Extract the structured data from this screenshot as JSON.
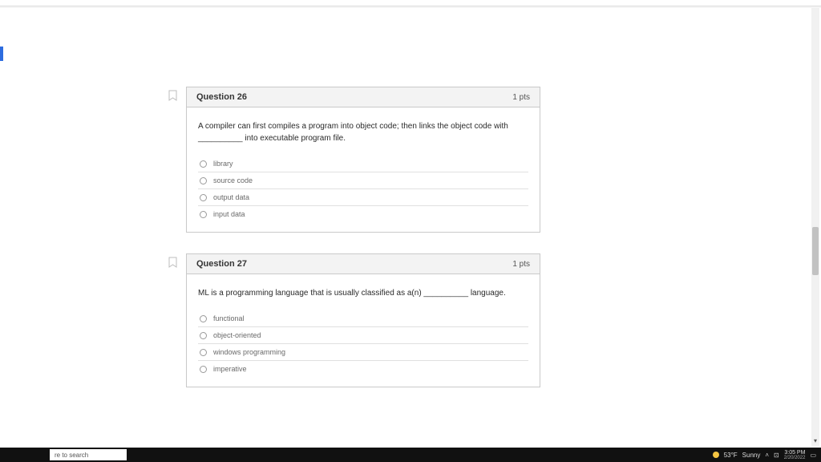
{
  "questions": [
    {
      "title": "Question 26",
      "pts": "1 pts",
      "prompt": "A compiler can first compiles a program into object code; then links the object code with __________ into executable program file.",
      "options": [
        "library",
        "source code",
        "output data",
        "input data"
      ]
    },
    {
      "title": "Question 27",
      "pts": "1 pts",
      "prompt": "ML is a programming language that is usually classified as a(n) __________ language.",
      "options": [
        "functional",
        "object-oriented",
        "windows programming",
        "imperative"
      ]
    }
  ],
  "taskbar": {
    "search_placeholder": "re to search",
    "weather_temp": "53°F",
    "weather_cond": "Sunny",
    "time": "3:05 PM",
    "date": "2/20/2022"
  }
}
